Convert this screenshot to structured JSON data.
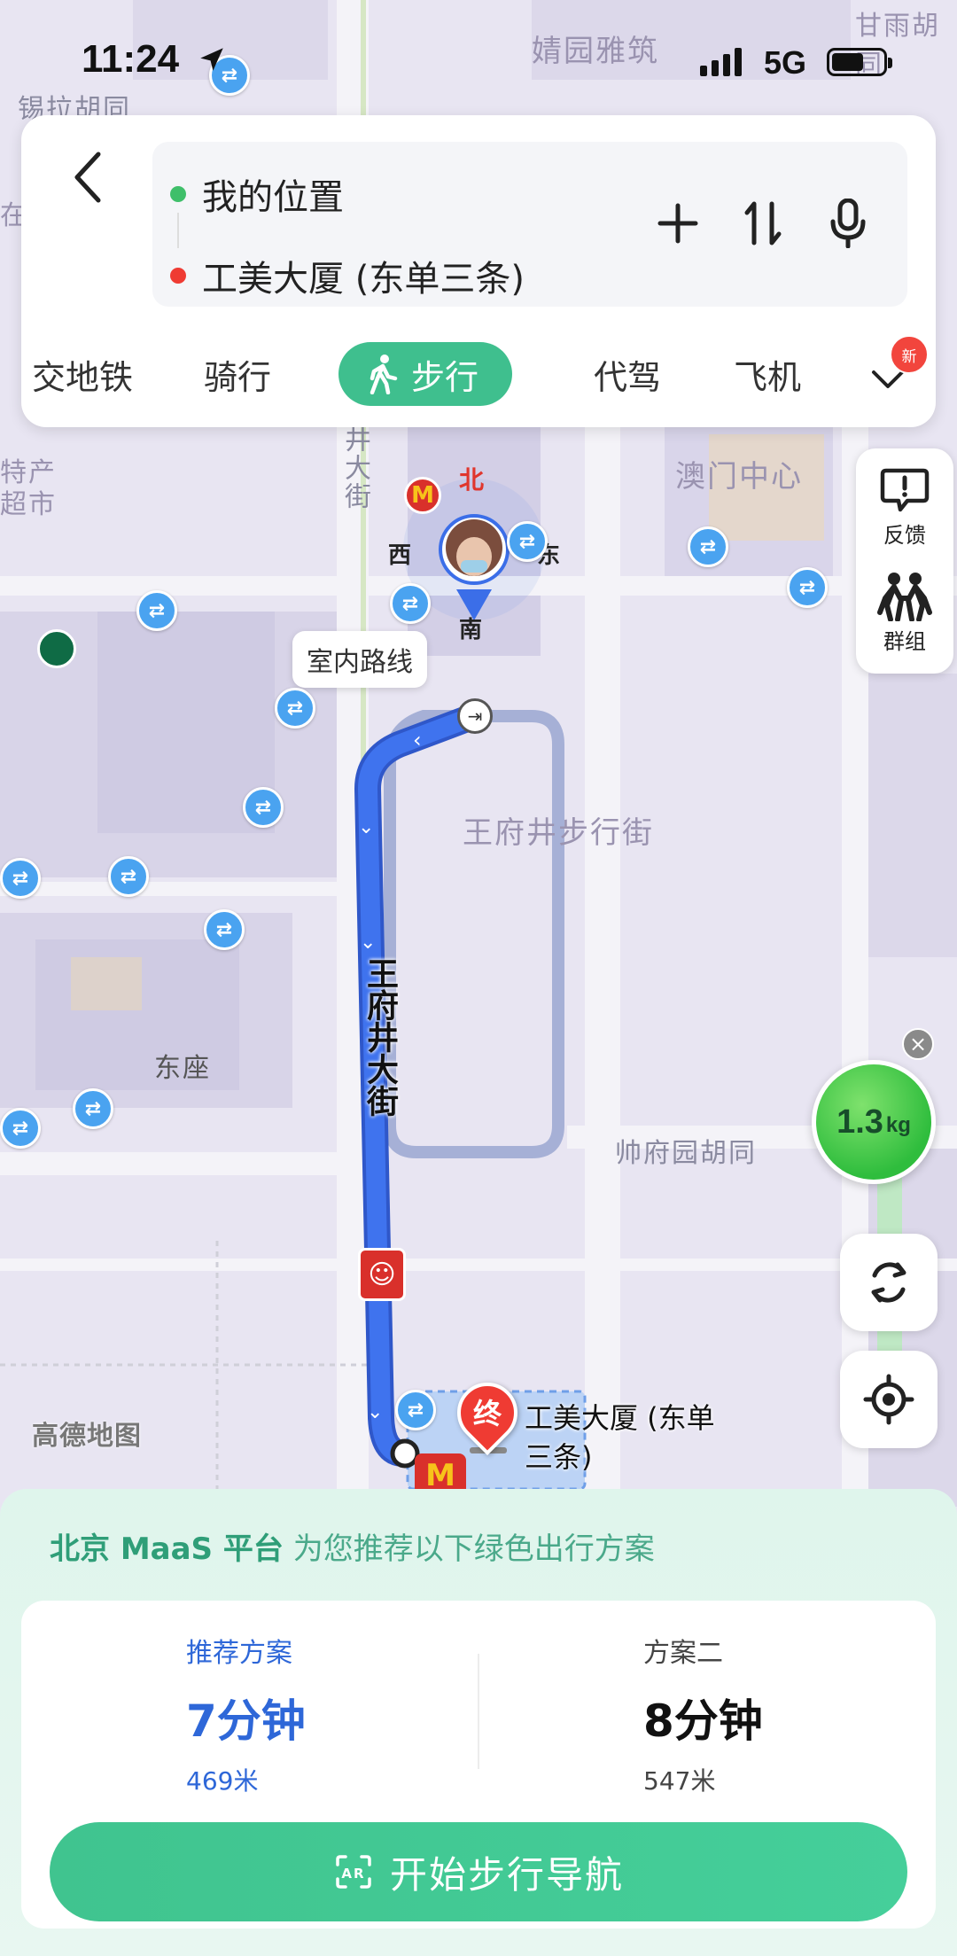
{
  "status_bar": {
    "time": "11:24",
    "network": "5G"
  },
  "search": {
    "origin": "我的位置",
    "destination": "工美大厦 (东单三条)"
  },
  "modes": {
    "tabs": [
      {
        "label": "交地铁"
      },
      {
        "label": "骑行"
      },
      {
        "label": "步行"
      },
      {
        "label": "代驾"
      },
      {
        "label": "飞机"
      }
    ],
    "new_badge": "新"
  },
  "side_tools": {
    "feedback": "反馈",
    "group": "群组"
  },
  "carbon": {
    "value": "1.3",
    "unit": "kg"
  },
  "map": {
    "labels": {
      "top_block": "婧园雅筑",
      "top_right": "甘雨胡同",
      "top_left": "锡拉胡同",
      "left_edge_1": "在",
      "left_edge_2": "特产",
      "left_edge_3": "超市",
      "right_top": "澳门中心",
      "wangfujing_street_v": "王府井大街",
      "wangfujing_street_top": "井大街",
      "pedestrian": "王府井步行街",
      "dongzuo": "东座",
      "shuaifu": "帅府园胡同",
      "dest_label": "工美大厦 (东单三条)",
      "indoor": "室内路线"
    },
    "compass": {
      "n": "北",
      "s": "南",
      "w": "西",
      "e": "东"
    },
    "end_marker": "终",
    "brand": "高德地图",
    "metro_glyph": "⇄"
  },
  "panel": {
    "maas_brand": "北京 MaaS 平台",
    "maas_text": "为您推荐以下绿色出行方案",
    "plan1": {
      "name": "推荐方案",
      "time": "7分钟",
      "distance": "469米"
    },
    "plan2": {
      "name": "方案二",
      "time": "8分钟",
      "distance": "547米"
    },
    "start_button": "开始步行导航"
  },
  "colors": {
    "accent_green": "#3fbf8e",
    "route_blue": "#3b6ee8",
    "brand_blue": "#2e67d8"
  }
}
